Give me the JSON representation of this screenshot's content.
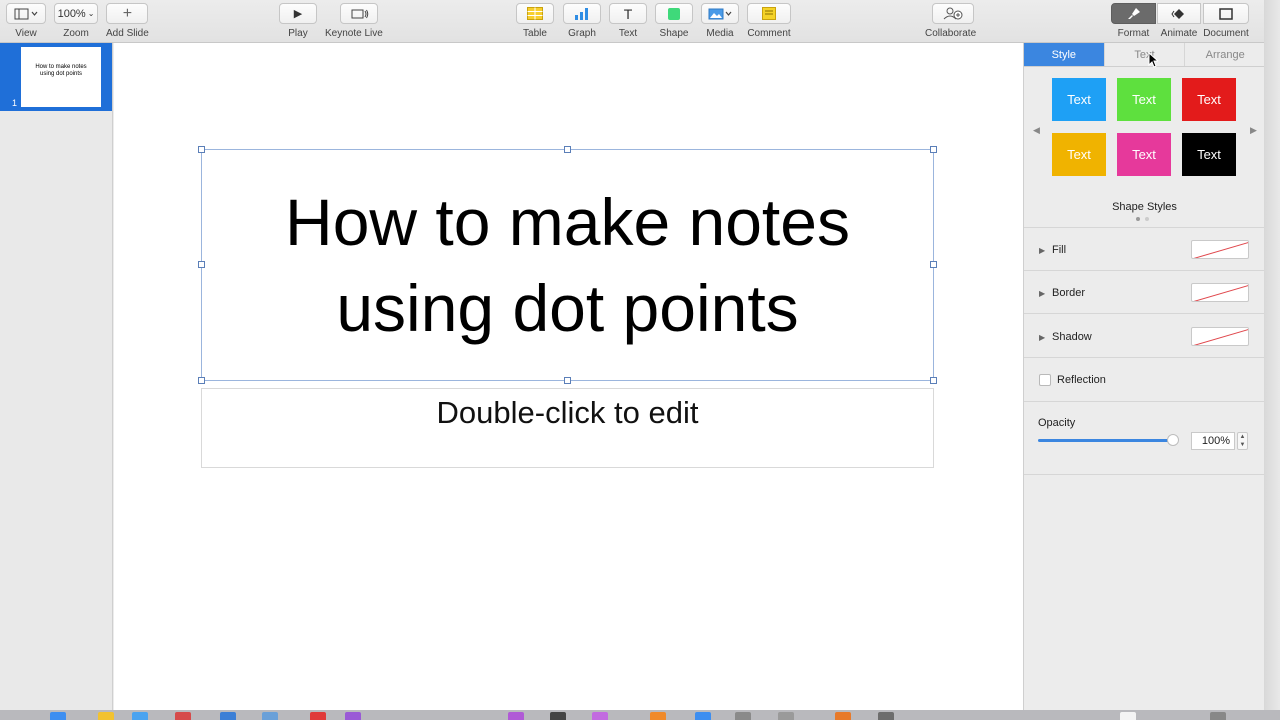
{
  "toolbar": {
    "view": "View",
    "zoom": "Zoom",
    "zoom_value": "100%",
    "add_slide": "Add Slide",
    "play": "Play",
    "keynote_live": "Keynote Live",
    "table": "Table",
    "graph": "Graph",
    "text": "Text",
    "shape": "Shape",
    "media": "Media",
    "comment": "Comment",
    "collaborate": "Collaborate",
    "format": "Format",
    "animate": "Animate",
    "document": "Document"
  },
  "navigator": {
    "slides": [
      {
        "number": "1",
        "title": "How to make notes using dot points"
      }
    ]
  },
  "slide": {
    "title_line1": "How to make notes",
    "title_line2": "using dot points",
    "subtitle_placeholder": "Double-click to edit"
  },
  "inspector": {
    "tabs": [
      "Style",
      "Text",
      "Arrange"
    ],
    "active_tab": "Style",
    "shape_styles_label": "Shape Styles",
    "shape_styles": [
      {
        "label": "Text",
        "color": "#1ea0f5"
      },
      {
        "label": "Text",
        "color": "#5ee03e"
      },
      {
        "label": "Text",
        "color": "#e31b1b"
      },
      {
        "label": "Text",
        "color": "#f0b300"
      },
      {
        "label": "Text",
        "color": "#e6399b"
      },
      {
        "label": "Text",
        "color": "#000000"
      }
    ],
    "fill": "Fill",
    "border": "Border",
    "shadow": "Shadow",
    "reflection": "Reflection",
    "opacity_label": "Opacity",
    "opacity_value": "100%"
  },
  "colors": {
    "accent": "#3b86e0",
    "selection": "#1f6fd8"
  }
}
